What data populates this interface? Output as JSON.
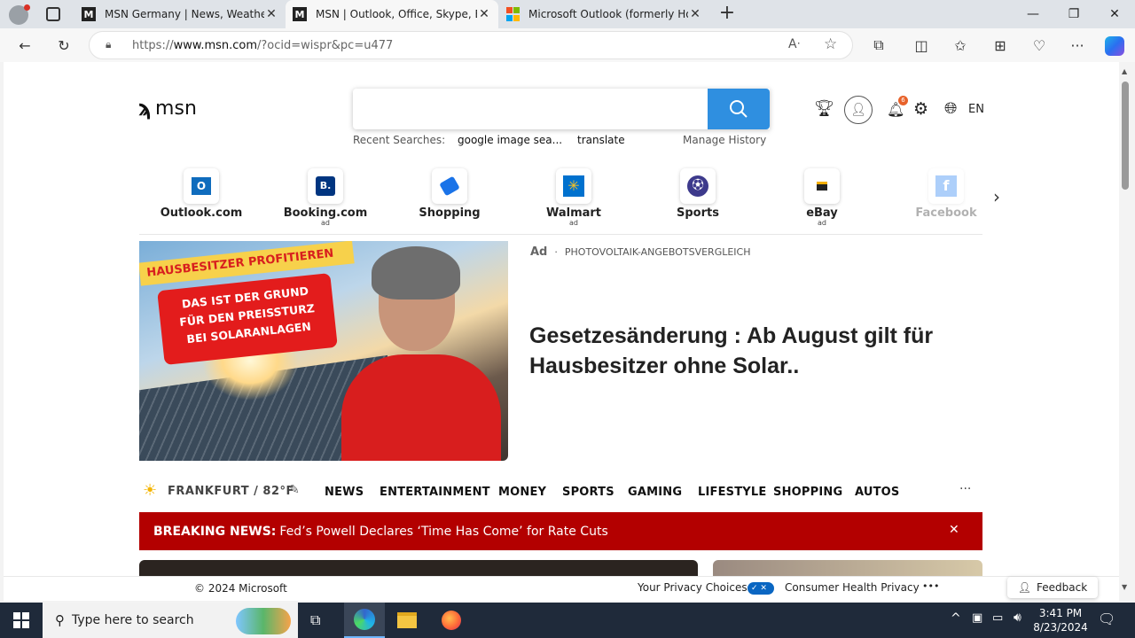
{
  "browser": {
    "tabs": [
      {
        "title": "MSN Germany | News, Weather,"
      },
      {
        "title": "MSN | Outlook, Office, Skype, Bi"
      },
      {
        "title": "Microsoft Outlook (formerly Hot"
      }
    ],
    "url_prefix": "https://",
    "url_domain": "www.msn.com",
    "url_rest": "/?ocid=wispr&pc=u477"
  },
  "msn": {
    "logo_text": "msn",
    "recent_label": "Recent Searches:",
    "recent": [
      "google image sea...",
      "translate"
    ],
    "manage_history": "Manage History",
    "notification_count": "6",
    "language": "EN",
    "quicklinks": [
      {
        "label": "Outlook.com",
        "ad": ""
      },
      {
        "label": "Booking.com",
        "ad": "ad"
      },
      {
        "label": "Shopping",
        "ad": ""
      },
      {
        "label": "Walmart",
        "ad": "ad"
      },
      {
        "label": "Sports",
        "ad": ""
      },
      {
        "label": "eBay",
        "ad": "ad"
      },
      {
        "label": "Facebook",
        "ad": ""
      }
    ],
    "hero": {
      "banner_top": "HAUSBESITZER PROFITIEREN",
      "banner_body": "DAS IST DER GRUND FÜR DEN PREISSTURZ BEI SOLARANLAGEN",
      "ad_label": "Ad",
      "sponsor": "PHOTOVOLTAIK-ANGEBOTSVERGLEICH",
      "headline": "Gesetzesänderung : Ab August gilt für Hausbesitzer ohne Solar.."
    },
    "weather": "FRANKFURT / 82°F",
    "nav": [
      "NEWS",
      "ENTERTAINMENT",
      "MONEY",
      "SPORTS",
      "GAMING",
      "LIFESTYLE",
      "SHOPPING",
      "AUTOS"
    ],
    "nav_more": "···",
    "breaking_label": "BREAKING NEWS:",
    "breaking_text": "Fed’s Powell Declares ‘Time Has Come’ for Rate Cuts",
    "footer": {
      "copyright": "© 2024 Microsoft",
      "privacy": "Your Privacy Choices",
      "health": "Consumer Health Privacy",
      "more": "•••",
      "feedback": "Feedback"
    }
  },
  "taskbar": {
    "search_placeholder": "Type here to search",
    "time": "3:41 PM",
    "date": "8/23/2024"
  },
  "colors": {
    "accent": "#2f8fe0",
    "breaking": "#b30000"
  }
}
